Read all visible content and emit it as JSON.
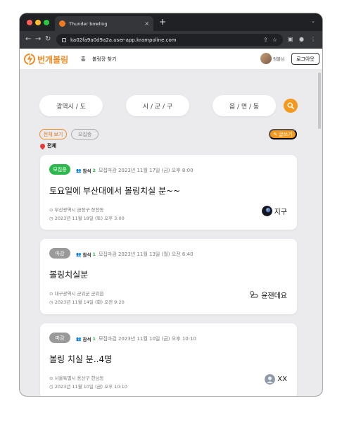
{
  "browser": {
    "tab_title": "Thunder bowling",
    "tab_close": "×",
    "new_tab": "+",
    "tab_menu": "⌄",
    "url": "ka02fa9a0d9a2a.user-app.krampoline.com"
  },
  "header": {
    "logo": "번개볼링",
    "nav": {
      "home": "홈",
      "find": "볼링장 찾기"
    },
    "user_name": "링볼님",
    "logout": "로그아웃"
  },
  "filters": {
    "region1": "광역시 / 도",
    "region2": "시 / 군 / 구",
    "region3": "읍 / 면 / 동",
    "chip_all": "전체 보기",
    "chip_recruiting": "모집중",
    "write": "글쓰기",
    "location": "전체"
  },
  "posts": [
    {
      "status": "모집중",
      "status_color": "#2db84c",
      "participate_label": "참석",
      "participate_count": "2",
      "deadline": "모집마감 2023년 11월 17일 (금) 오후 8:00",
      "title": "토요일에 부산대에서 볼링치실 분~~",
      "location": "부산광역시 금정구 장전동",
      "date": "2023년 11월 18일 (토) 오후 3:00",
      "author": "지구",
      "avatar_icon": "earth-avatar-icon"
    },
    {
      "status": "마감",
      "status_color": "#9a9a9a",
      "participate_label": "참석",
      "participate_count": "1",
      "deadline": "모집마감 2023년 11월 13일 (월) 오전 6:40",
      "title": "볼링치실분",
      "location": "대구광역시 군위군 군위읍",
      "date": "2023년 11월 14일 (화) 오전 9:20",
      "author": "윤잰데요",
      "avatar_icon": "weather-avatar-icon"
    },
    {
      "status": "마감",
      "status_color": "#9a9a9a",
      "participate_label": "참석",
      "participate_count": "1",
      "deadline": "모집마감 2023년 11월 10일 (금) 오후 10:10",
      "title": "볼링 치실 분..4명",
      "location": "서울특별시 용산구 한남동",
      "date": "2023년 11월 10일 (금) 오후 10:10",
      "author": "XX",
      "avatar_icon": "default-user-avatar-icon"
    }
  ],
  "colors": {
    "brand": "#f08a24",
    "accent": "#f39a1e"
  }
}
